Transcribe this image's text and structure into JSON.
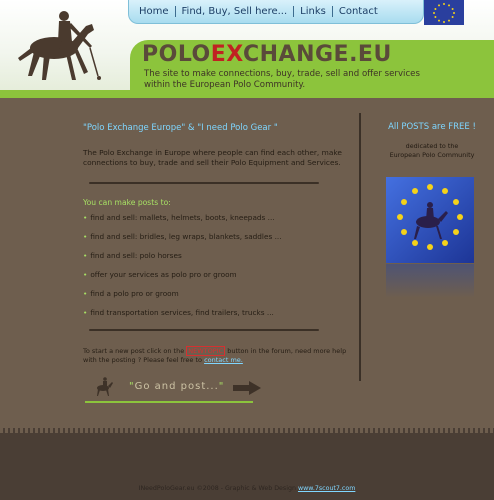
{
  "nav": {
    "items": [
      "Home",
      "Find, Buy, Sell here...",
      "Links",
      "Contact"
    ]
  },
  "brand": {
    "part1": "POLO",
    "part2": "EX",
    "part3": "CHANGE.EU",
    "tagline_1": "The site to make connections, buy, trade, sell and offer services",
    "tagline_2": "within the European Polo Community."
  },
  "main": {
    "headline": "\"Polo Exchange Europe\" & \"I need Polo Gear \"",
    "intro": "The Polo Exchange in Europe where people can find each other, make connections to buy, trade and sell their Polo Equipment and Services.",
    "sub_heading": "You can make posts to:",
    "posts": [
      "find and sell: mallets, helmets, boots, kneepads ...",
      "find and sell: bridles, leg wraps, blankets, saddles ...",
      "find and sell: polo horses",
      "offer your services as polo pro or groom",
      "find a polo pro or groom",
      "find transportation services, find trailers, trucks ..."
    ],
    "howto_1": "To start a new post click on the",
    "newtopic": "NEWTOPIC",
    "howto_2": "button in the forum, need more help with the posting ? Please feel free to",
    "contact": "contact me.",
    "go_text": "Go and post...",
    "quote_open": "\"",
    "quote_close": "\""
  },
  "side": {
    "free": "All POSTS are FREE !",
    "dedicated_1": "dedicated to the",
    "dedicated_2": "European Polo Community"
  },
  "footer": {
    "text": "INeedPoloGear.eu ©2008 - Graphic & Web Design",
    "link": "www.7scout7.com"
  },
  "colors": {
    "accent_blue": "#7fd6ff",
    "accent_green": "#a7e064",
    "brand_red": "#c02222",
    "grass_green": "#8cc43c",
    "background": "#6e5e4e"
  }
}
